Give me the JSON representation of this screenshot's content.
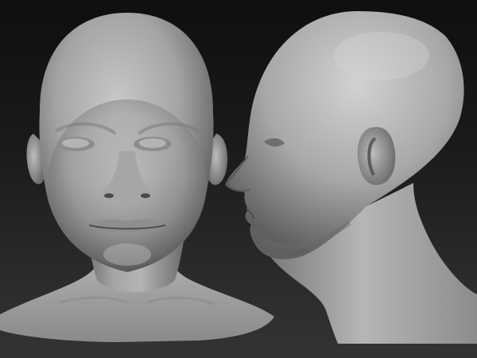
{
  "scene": {
    "subject": "sculpted-head-front-and-profile",
    "material": "matte-grey-clay",
    "colors": {
      "background_top": "#0f0f0f",
      "background_bottom": "#333333",
      "clay_light": "#c9c9c9",
      "clay_mid": "#9a9a9a",
      "clay_dark": "#4a4a4a"
    }
  }
}
